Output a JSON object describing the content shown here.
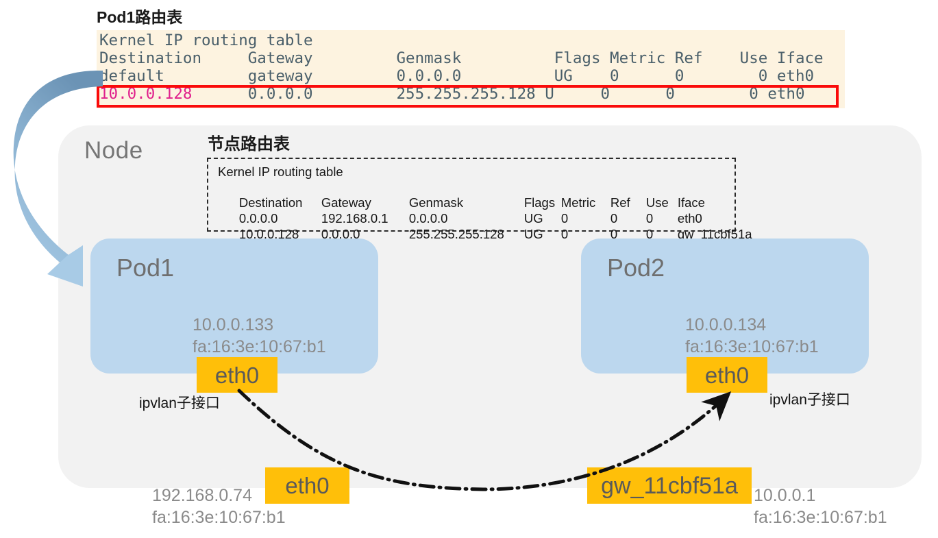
{
  "pod1_route_table": {
    "title": "Pod1路由表",
    "header_line": "Kernel IP routing table",
    "columns": "Destination     Gateway         Genmask          Flags Metric Ref    Use Iface",
    "row_default": "default         gateway         0.0.0.0          UG    0      0        0 eth0",
    "row_highlight_dest": "10.0.0.128",
    "row_highlight_rest": "      0.0.0.0         255.255.255.128 U     0      0        0 eth0",
    "rows": [
      {
        "destination": "default",
        "gateway": "gateway",
        "genmask": "0.0.0.0",
        "flags": "UG",
        "metric": "0",
        "ref": "0",
        "use": "0",
        "iface": "eth0",
        "highlighted": false
      },
      {
        "destination": "10.0.0.128",
        "gateway": "0.0.0.0",
        "genmask": "255.255.255.128",
        "flags": "U",
        "metric": "0",
        "ref": "0",
        "use": "0",
        "iface": "eth0",
        "highlighted": true
      }
    ],
    "highlight_color": "#fa0a0a",
    "highlight_text_color": "#e0208c",
    "background_color": "#fdf3e0",
    "text_color": "#4a5f6a"
  },
  "node_route_table": {
    "title": "节点路由表",
    "header_line": "Kernel IP routing table",
    "headers": {
      "destination": "Destination",
      "gateway": "Gateway",
      "genmask": "Genmask",
      "flags": "Flags",
      "metric": "Metric",
      "ref": "Ref",
      "use": "Use",
      "iface": "Iface"
    },
    "rows": [
      {
        "destination": "0.0.0.0",
        "gateway": "192.168.0.1",
        "genmask": "0.0.0.0",
        "flags": "UG",
        "metric": "0",
        "ref": "0",
        "use": "0",
        "iface": "eth0"
      },
      {
        "destination": "10.0.0.128",
        "gateway": "0.0.0.0",
        "genmask": "255.255.255.128",
        "flags": "UG",
        "metric": "0",
        "ref": "0",
        "use": "0",
        "iface": "gw_11cbf51a"
      }
    ]
  },
  "node": {
    "label": "Node",
    "background_color": "#f2f2f2"
  },
  "pod1": {
    "label": "Pod1",
    "ip": "10.0.0.133",
    "mac": "fa:16:3e:10:67:b1",
    "interface_badge": "eth0",
    "interface_note": "ipvlan子接口",
    "background_color": "#bcd7ee"
  },
  "pod2": {
    "label": "Pod2",
    "ip": "10.0.0.134",
    "mac": "fa:16:3e:10:67:b1",
    "interface_badge": "eth0",
    "interface_note": "ipvlan子接口",
    "background_color": "#bcd7ee"
  },
  "host_interfaces": {
    "eth0": {
      "badge": "eth0",
      "ip": "192.168.0.74",
      "mac": "fa:16:3e:10:67:b1"
    },
    "gateway": {
      "badge": "gw_11cbf51a",
      "ip": "10.0.0.1",
      "mac": "fa:16:3e:10:67:b1"
    }
  },
  "badge_color": "#ffbf09",
  "badge_text_color": "#5a5a5a",
  "arrows": {
    "route_to_pod1": "curved blue arrow from highlighted route row to Pod1",
    "pod1_to_pod2": "dash-dot curved arrow from Pod1 eth0 to Pod2 eth0"
  }
}
